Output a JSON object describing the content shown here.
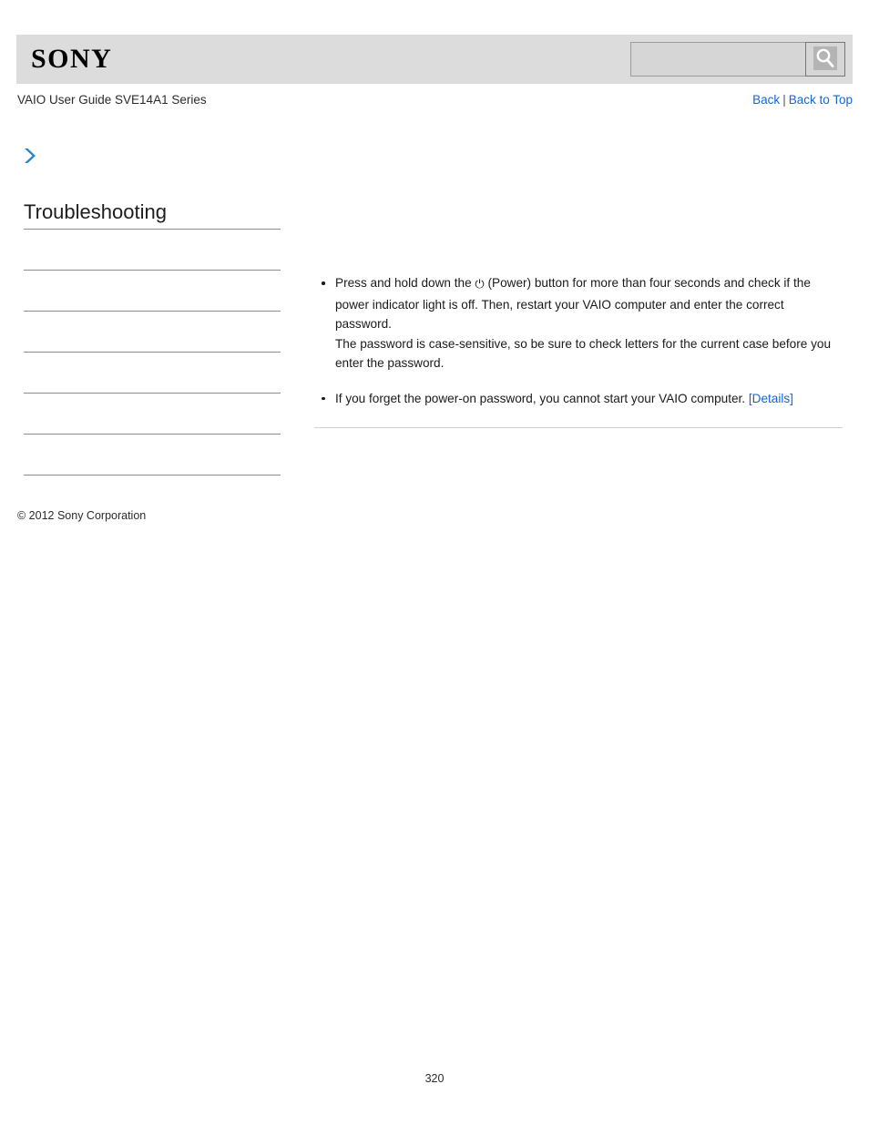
{
  "header": {
    "logo_text": "SONY",
    "search": {
      "value": "",
      "placeholder": "",
      "icon": "search-icon",
      "button_label": ""
    }
  },
  "subheader": {
    "guide_title": "VAIO User Guide SVE14A1 Series",
    "links": {
      "back": "Back",
      "separator": "|",
      "back_to_top": "Back to Top"
    }
  },
  "breadcrumb": {
    "icon": "chevron-right-icon",
    "text": ""
  },
  "sidebar": {
    "title": "Troubleshooting",
    "slots": [
      "",
      "",
      "",
      "",
      "",
      ""
    ]
  },
  "main": {
    "bullets": [
      {
        "prefix": "Press and hold down the ",
        "icon_glyph": "⏻",
        "icon_name": "power-icon",
        "suffix": " (Power) button for more than four seconds and check if the power indicator light is off. Then, restart your VAIO computer and enter the correct password.",
        "second_line": "The password is case-sensitive, so be sure to check letters for the current case before you enter the password."
      },
      {
        "text": "If you forget the power-on password, you cannot start your VAIO computer. ",
        "link_label": "[Details]"
      }
    ]
  },
  "footer": {
    "copyright": "© 2012 Sony Corporation",
    "page_number": "320"
  },
  "colors": {
    "header_bg": "#dcdcdc",
    "link_blue": "#1565d8",
    "chevron_blue": "#2b86c8",
    "rule_gray": "#8c8c8c",
    "content_rule_gray": "#d2d2d2"
  }
}
